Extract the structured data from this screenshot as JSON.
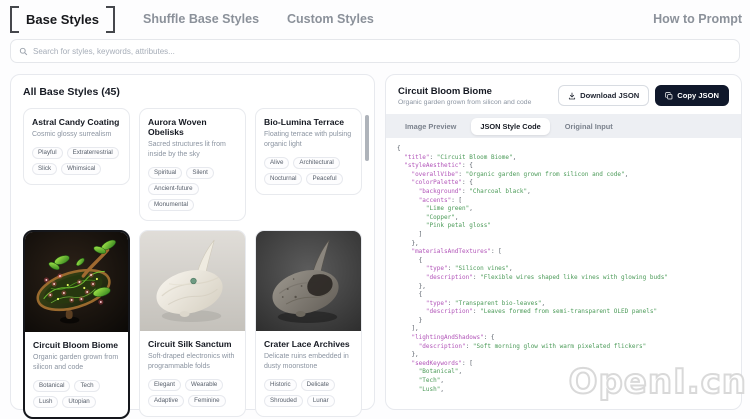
{
  "nav": {
    "active_label": "Base Styles",
    "items": [
      "Shuffle Base Styles",
      "Custom Styles"
    ],
    "right_label": "How to Prompt"
  },
  "search": {
    "placeholder": "Search for styles, keywords, attributes..."
  },
  "library": {
    "header": "All Base Styles (45)",
    "cards": [
      {
        "title": "Astral Candy Coating",
        "description": "Cosmic glossy surrealism",
        "tags": [
          "Playful",
          "Extraterrestrial",
          "Slick",
          "Whimsical"
        ]
      },
      {
        "title": "Aurora Woven Obelisks",
        "description": "Sacred structures lit from inside by the sky",
        "tags": [
          "Spiritual",
          "Silent",
          "Ancient-future",
          "Monumental"
        ]
      },
      {
        "title": "Bio-Lumina Terrace",
        "description": "Floating terrace with pulsing organic light",
        "tags": [
          "Alive",
          "Architectural",
          "Nocturnal",
          "Peaceful"
        ]
      },
      {
        "title": "Circuit Bloom Biome",
        "description": "Organic garden grown from silicon and code",
        "tags": [
          "Botanical",
          "Tech",
          "Lush",
          "Utopian"
        ],
        "selected": true,
        "image": "circuit-bloom-photo"
      },
      {
        "title": "Circuit Silk Sanctum",
        "description": "Soft-draped electronics with programmable folds",
        "tags": [
          "Elegant",
          "Wearable",
          "Adaptive",
          "Feminine"
        ],
        "image": "silk-sanctum-photo"
      },
      {
        "title": "Crater Lace Archives",
        "description": "Delicate ruins embedded in dusty moonstone",
        "tags": [
          "Historic",
          "Delicate",
          "Shrouded",
          "Lunar"
        ],
        "image": "crater-lace-photo"
      }
    ]
  },
  "detail": {
    "title": "Circuit Bloom Biome",
    "subtitle": "Organic garden grown from silicon and code",
    "download_label": "Download JSON",
    "copy_label": "Copy JSON",
    "tabs": [
      {
        "label": "Image Preview",
        "active": false
      },
      {
        "label": "JSON Style Code",
        "active": true
      },
      {
        "label": "Original Input",
        "active": false
      }
    ],
    "json_code": "{\n  \"title\": \"Circuit Bloom Biome\",\n  \"styleAesthetic\": {\n    \"overallVibe\": \"Organic garden grown from silicon and code\",\n    \"colorPalette\": {\n      \"background\": \"Charcoal black\",\n      \"accents\": [\n        \"Lime green\",\n        \"Copper\",\n        \"Pink petal gloss\"\n      ]\n    },\n    \"materialsAndTextures\": [\n      {\n        \"type\": \"Silicon vines\",\n        \"description\": \"Flexible wires shaped like vines with glowing buds\"\n      },\n      {\n        \"type\": \"Transparent bio-leaves\",\n        \"description\": \"Leaves formed from semi-transparent OLED panels\"\n      }\n    ],\n    \"lightingAndShadows\": {\n      \"description\": \"Soft morning glow with warm pixelated flickers\"\n    },\n    \"seedKeywords\": [\n      \"Botanical\",\n      \"Tech\",\n      \"Lush\","
  },
  "watermark": "OpenI.cn",
  "colors": {
    "accent_dark": "#10182b",
    "json_key": "#b153b8",
    "json_string": "#4a9a57",
    "tab_bar_bg": "#edeff3"
  }
}
